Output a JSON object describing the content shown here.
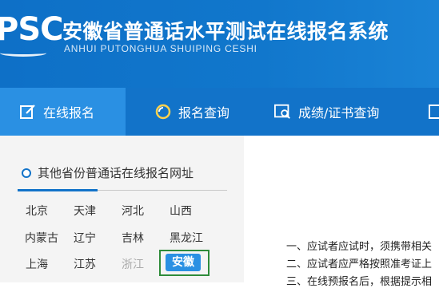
{
  "header": {
    "logo_text": "PSC",
    "title": "安徽省普通话水平测试在线报名系统",
    "subtitle": "ANHUI PUTONGHUA SHUIPING CESHI"
  },
  "nav": {
    "items": [
      {
        "label": "在线报名",
        "icon": "edit-icon"
      },
      {
        "label": "报名查询",
        "icon": "search-icon"
      },
      {
        "label": "成绩/证书查询",
        "icon": "certificate-search-icon"
      }
    ]
  },
  "colors": {
    "header_blue": "#1273c9",
    "active_tab": "#2a90e3",
    "selected_outline": "#2e8b3a"
  },
  "sidebar": {
    "title": "其他省份普通话在线报名网址",
    "provinces": [
      {
        "label": "北京"
      },
      {
        "label": "天津"
      },
      {
        "label": "河北"
      },
      {
        "label": "山西"
      },
      {
        "label": "内蒙古"
      },
      {
        "label": "辽宁"
      },
      {
        "label": "吉林"
      },
      {
        "label": "黑龙江"
      },
      {
        "label": "上海"
      },
      {
        "label": "江苏"
      },
      {
        "label": "浙江"
      },
      {
        "label": "安徽"
      }
    ]
  },
  "content": {
    "notices": [
      "一、应试者应试时，须携带相关",
      "二、应试者应严格按照准考证上",
      "三、在线预报名后，根据提示相"
    ]
  }
}
